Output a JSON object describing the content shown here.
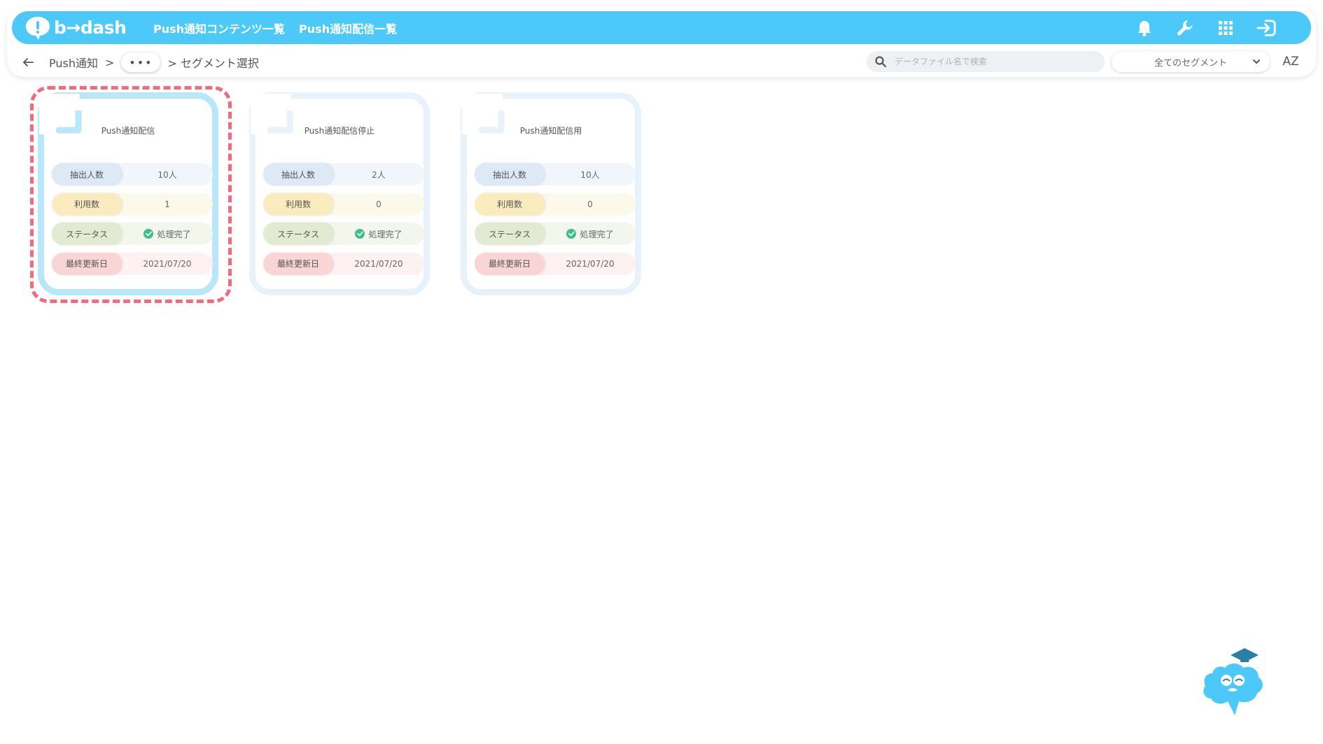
{
  "header": {
    "logo_text": "b→dash",
    "nav": [
      "Push通知コンテンツ一覧",
      "Push通知配信一覧"
    ],
    "icons": [
      "bell-icon",
      "wrench-icon",
      "apps-grid-icon",
      "logout-icon"
    ]
  },
  "breadcrumb": {
    "root": "Push通知",
    "sep": ">",
    "more": "•••",
    "current": "> セグメント選択"
  },
  "search": {
    "placeholder": "データファイル名で検索"
  },
  "segment_filter": {
    "selected": "全てのセグメント"
  },
  "sort": {
    "label": "AZ"
  },
  "row_labels": {
    "extract": "抽出人数",
    "usage": "利用数",
    "status": "ステータス",
    "updated": "最終更新日"
  },
  "cards": [
    {
      "title": "Push通知配信",
      "extract": "10人",
      "usage": "1",
      "status": "処理完了",
      "updated": "2021/07/20",
      "selected": true
    },
    {
      "title": "Push通知配信停止",
      "extract": "2人",
      "usage": "0",
      "status": "処理完了",
      "updated": "2021/07/20",
      "selected": false
    },
    {
      "title": "Push通知配信用",
      "extract": "10人",
      "usage": "0",
      "status": "処理完了",
      "updated": "2021/07/20",
      "selected": false
    }
  ],
  "colors": {
    "brand": "#4cc9f8",
    "highlight": "#f26b7d",
    "status_ok": "#3cbf8b"
  }
}
